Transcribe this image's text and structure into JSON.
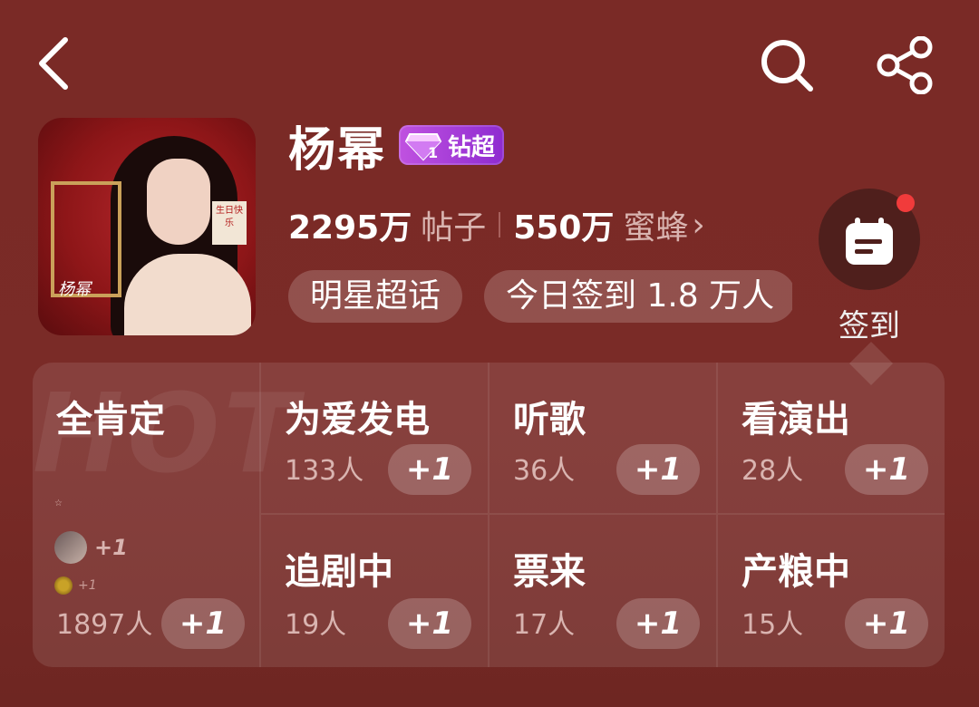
{
  "header": {
    "back_icon": "chevron-left-icon",
    "search_icon": "search-icon",
    "share_icon": "share-icon"
  },
  "profile": {
    "title": "杨幂",
    "badge_label": "钻超",
    "badge_level": "1",
    "stats": {
      "posts_value": "2295万",
      "posts_label": "帖子",
      "fans_value": "550万",
      "fans_label": "蜜蜂",
      "chevron": "›"
    },
    "chips": [
      "明星超话",
      "今日签到 1.8 万人"
    ],
    "checkin_label": "签到"
  },
  "avatar_text": {
    "tag": "生日快乐",
    "signature": "杨幂"
  },
  "activity": {
    "watermark": "HOT",
    "featured": {
      "name": "全肯定",
      "count": "1897人",
      "plus": "+1",
      "mini_plus_1": "+1",
      "mini_plus_2": "+1",
      "tiny": "☆"
    },
    "items": [
      {
        "name": "为爱发电",
        "count": "133人",
        "plus": "+1"
      },
      {
        "name": "听歌",
        "count": "36人",
        "plus": "+1"
      },
      {
        "name": "看演出",
        "count": "28人",
        "plus": "+1"
      },
      {
        "name": "追剧中",
        "count": "19人",
        "plus": "+1"
      },
      {
        "name": "票来",
        "count": "17人",
        "plus": "+1"
      },
      {
        "name": "产粮中",
        "count": "15人",
        "plus": "+1"
      }
    ]
  },
  "colors": {
    "background": "#7a2a26",
    "badge": "#b048da",
    "dot": "#f13b3b"
  }
}
